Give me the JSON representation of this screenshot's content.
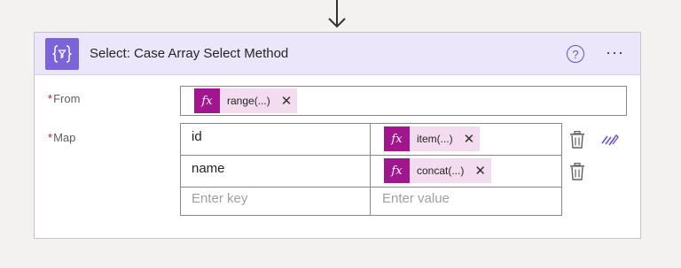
{
  "action": {
    "title": "Select: Case Array Select Method",
    "icon": "select-filter-icon",
    "accent_color": "#7b63d9",
    "header_bg": "#ece6fb"
  },
  "header_buttons": {
    "help_glyph": "?",
    "more_glyph": "···"
  },
  "from": {
    "label": "From",
    "required_mark": "*",
    "token": {
      "fx": "fx",
      "label": "range(...)"
    }
  },
  "map": {
    "label": "Map",
    "required_mark": "*",
    "rows": [
      {
        "key": "id",
        "token": {
          "fx": "fx",
          "label": "item(...)"
        }
      },
      {
        "key": "name",
        "token": {
          "fx": "fx",
          "label": "concat(...)"
        }
      }
    ],
    "key_placeholder": "Enter key",
    "value_placeholder": "Enter value"
  },
  "token_color": "#a1168e",
  "token_bg": "#f3dcef",
  "close_glyph": "✕"
}
